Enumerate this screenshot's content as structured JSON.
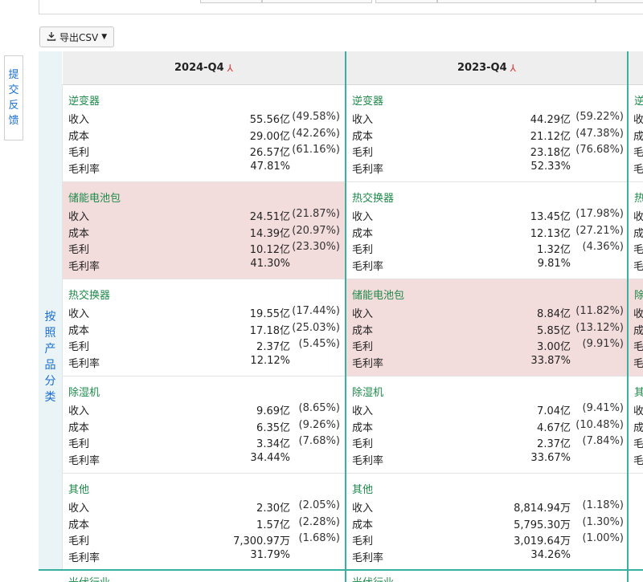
{
  "toolbar": {
    "csv_label": "导出CSV"
  },
  "feedback": {
    "label": "提交反馈"
  },
  "row_header": {
    "label": "按照产品分类"
  },
  "columns": [
    {
      "period": "2024-Q4",
      "cells": [
        {
          "category": "逆变器",
          "highlight": false,
          "revenue": "55.56亿",
          "revenue_pct": "(49.58%)",
          "cost": "29.00亿",
          "cost_pct": "(42.26%)",
          "gross": "26.57亿",
          "gross_pct": "(61.16%)",
          "margin": "47.81%"
        },
        {
          "category": "储能电池包",
          "highlight": true,
          "revenue": "24.51亿",
          "revenue_pct": "(21.87%)",
          "cost": "14.39亿",
          "cost_pct": "(20.97%)",
          "gross": "10.12亿",
          "gross_pct": "(23.30%)",
          "margin": "41.30%"
        },
        {
          "category": "热交换器",
          "highlight": false,
          "revenue": "19.55亿",
          "revenue_pct": "(17.44%)",
          "cost": "17.18亿",
          "cost_pct": "(25.03%)",
          "gross": "2.37亿",
          "gross_pct": "(5.45%)",
          "margin": "12.12%"
        },
        {
          "category": "除湿机",
          "highlight": false,
          "revenue": "9.69亿",
          "revenue_pct": "(8.65%)",
          "cost": "6.35亿",
          "cost_pct": "(9.26%)",
          "gross": "3.34亿",
          "gross_pct": "(7.68%)",
          "margin": "34.44%"
        },
        {
          "category": "其他",
          "highlight": false,
          "revenue": "2.30亿",
          "revenue_pct": "(2.05%)",
          "cost": "1.57亿",
          "cost_pct": "(2.28%)",
          "gross": "7,300.97万",
          "gross_pct": "(1.68%)",
          "margin": "31.79%"
        }
      ]
    },
    {
      "period": "2023-Q4",
      "cells": [
        {
          "category": "逆变器",
          "highlight": false,
          "revenue": "44.29亿",
          "revenue_pct": "(59.22%)",
          "cost": "21.12亿",
          "cost_pct": "(47.38%)",
          "gross": "23.18亿",
          "gross_pct": "(76.68%)",
          "margin": "52.33%"
        },
        {
          "category": "热交换器",
          "highlight": false,
          "revenue": "13.45亿",
          "revenue_pct": "(17.98%)",
          "cost": "12.13亿",
          "cost_pct": "(27.21%)",
          "gross": "1.32亿",
          "gross_pct": "(4.36%)",
          "margin": "9.81%"
        },
        {
          "category": "储能电池包",
          "highlight": true,
          "revenue": "8.84亿",
          "revenue_pct": "(11.82%)",
          "cost": "5.85亿",
          "cost_pct": "(13.12%)",
          "gross": "3.00亿",
          "gross_pct": "(9.91%)",
          "margin": "33.87%"
        },
        {
          "category": "除湿机",
          "highlight": false,
          "revenue": "7.04亿",
          "revenue_pct": "(9.41%)",
          "cost": "4.67亿",
          "cost_pct": "(10.48%)",
          "gross": "2.37亿",
          "gross_pct": "(7.84%)",
          "margin": "33.67%"
        },
        {
          "category": "其他",
          "highlight": false,
          "revenue": "8,814.94万",
          "revenue_pct": "(1.18%)",
          "cost": "5,795.30万",
          "cost_pct": "(1.30%)",
          "gross": "3,019.64万",
          "gross_pct": "(1.00%)",
          "margin": "34.26%"
        }
      ]
    }
  ],
  "partial_column": {
    "cells": [
      {
        "category": "逆",
        "highlight": false
      },
      {
        "category": "热",
        "highlight": false
      },
      {
        "category": "除",
        "highlight": true
      },
      {
        "category": "其",
        "highlight": false
      },
      {
        "category": "",
        "highlight": false
      }
    ],
    "row_labels": [
      "收",
      "成",
      "毛",
      "毛"
    ]
  },
  "labels": {
    "revenue": "收入",
    "cost": "成本",
    "gross": "毛利",
    "margin": "毛利率"
  },
  "next_section": {
    "label": "光伏行业"
  },
  "colors": {
    "accent": "#3ab0a0",
    "category": "#1d8a4a",
    "link": "#1a6fd1",
    "highlight": "#f3dcdc"
  }
}
